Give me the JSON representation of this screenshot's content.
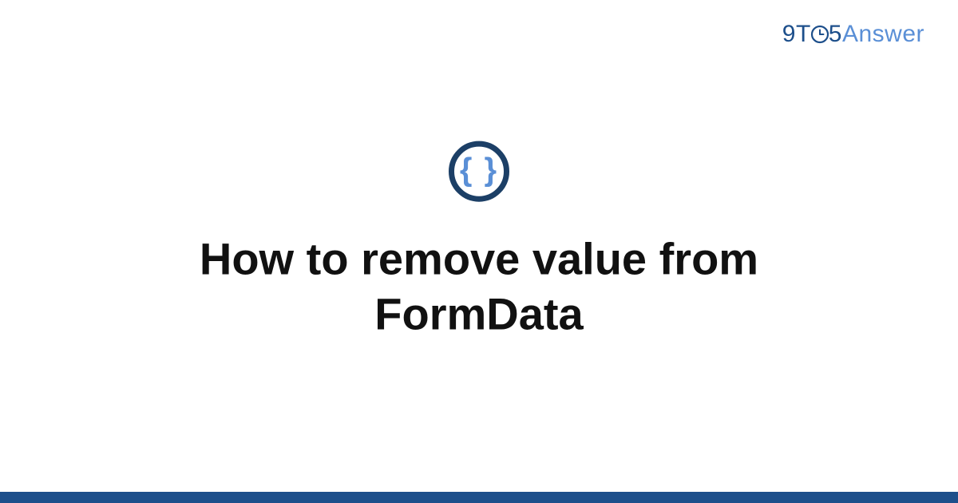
{
  "brand": {
    "prefix_9": "9",
    "prefix_T": "T",
    "middle_5": "5",
    "suffix": "Answer",
    "colors": {
      "primary": "#1d4f8b",
      "accent": "#5a8fd6",
      "text": "#111111"
    }
  },
  "badge": {
    "glyph": "{ }",
    "semantic": "code-braces-icon"
  },
  "main": {
    "title": "How to remove value from FormData"
  }
}
